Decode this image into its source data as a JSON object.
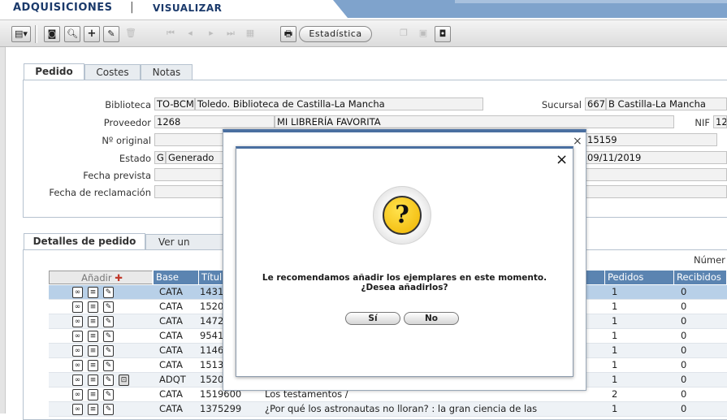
{
  "header": {
    "module": "ADQUISICIONES",
    "separator": "|",
    "mode": "VISUALIZAR"
  },
  "toolbar": {
    "statistics_label": "Estadística"
  },
  "main_tabs": [
    "Pedido",
    "Costes",
    "Notas"
  ],
  "order": {
    "biblioteca_label": "Biblioteca",
    "biblioteca_code": "TO-BCM",
    "biblioteca_name": "Toledo. Biblioteca de Castilla-La Mancha",
    "sucursal_label": "Sucursal",
    "sucursal_code": "667",
    "sucursal_name": "B Castilla-La Mancha",
    "proveedor_label": "Proveedor",
    "proveedor_code": "1268",
    "proveedor_name": "MI LIBRERÍA FAVORITA",
    "nif_label": "NIF",
    "nif_value": "12",
    "original_label": "Nº original",
    "original_right": "15159",
    "estado_label": "Estado",
    "estado_code": "G",
    "estado_name": "Generado",
    "estado_date": "09/11/2019",
    "prevista_label": "Fecha prevista",
    "reclamacion_label": "Fecha de reclamación"
  },
  "detail_tabs": [
    "Detalles de pedido",
    "Ver un detalle"
  ],
  "numero_label": "Númer",
  "table": {
    "add_label": "Añadir",
    "columns": [
      "Base",
      "Títul",
      "Pedidos",
      "Recibidos"
    ],
    "rows": [
      {
        "base": "CATA",
        "num": "1431",
        "title": "",
        "pedidos": "1",
        "recibidos": "0"
      },
      {
        "base": "CATA",
        "num": "1520",
        "title": "",
        "pedidos": "1",
        "recibidos": "0"
      },
      {
        "base": "CATA",
        "num": "1472",
        "title": "",
        "pedidos": "1",
        "recibidos": "0"
      },
      {
        "base": "CATA",
        "num": "9541",
        "title": "",
        "pedidos": "1",
        "recibidos": "0"
      },
      {
        "base": "CATA",
        "num": "1146",
        "title": "",
        "pedidos": "1",
        "recibidos": "0"
      },
      {
        "base": "CATA",
        "num": "1513",
        "title": "",
        "pedidos": "1",
        "recibidos": "0"
      },
      {
        "base": "ADQT",
        "num": "1520",
        "title": "",
        "pedidos": "1",
        "recibidos": "0"
      },
      {
        "base": "CATA",
        "num": "1519600",
        "title": "Los testamentos /",
        "pedidos": "2",
        "recibidos": "0"
      },
      {
        "base": "CATA",
        "num": "1375299",
        "title": "¿Por qué los astronautas no lloran? : la gran ciencia de las",
        "pedidos": "1",
        "recibidos": "0"
      }
    ]
  },
  "dialog": {
    "icon": "question-icon",
    "question_mark": "?",
    "line1": "Le recomendamos añadir los ejemplares en este momento.",
    "line2": "¿Desea añadirlos?",
    "yes": "Sí",
    "no": "No",
    "close": "×"
  }
}
